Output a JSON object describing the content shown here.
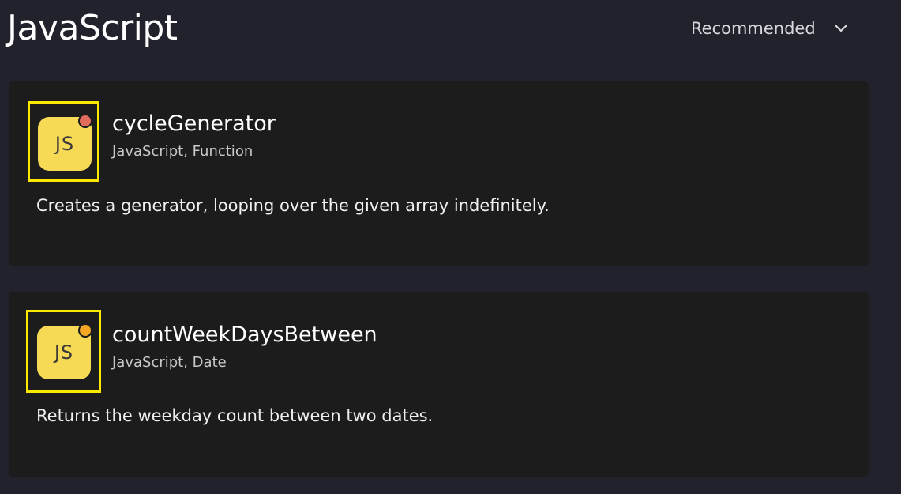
{
  "header": {
    "title": "JavaScript",
    "sort": {
      "selected": "Recommended",
      "icon": "chevron-down-icon"
    }
  },
  "snippets": [
    {
      "title": "cycleGenerator",
      "tags": "JavaScript, Function",
      "description": "Creates a generator, looping over the given array indefinitely.",
      "badge_text": "JS",
      "badge_color": "#f6d955",
      "status_dot_color": "#e06c5c"
    },
    {
      "title": "countWeekDaysBetween",
      "tags": "JavaScript, Date",
      "description": "Returns the weekday count between two dates.",
      "badge_text": "JS",
      "badge_color": "#f6d955",
      "status_dot_color": "#f5a623"
    }
  ],
  "colors": {
    "background": "#22222c",
    "card": "#1c1c1c",
    "highlight_frame": "#ffe800"
  }
}
